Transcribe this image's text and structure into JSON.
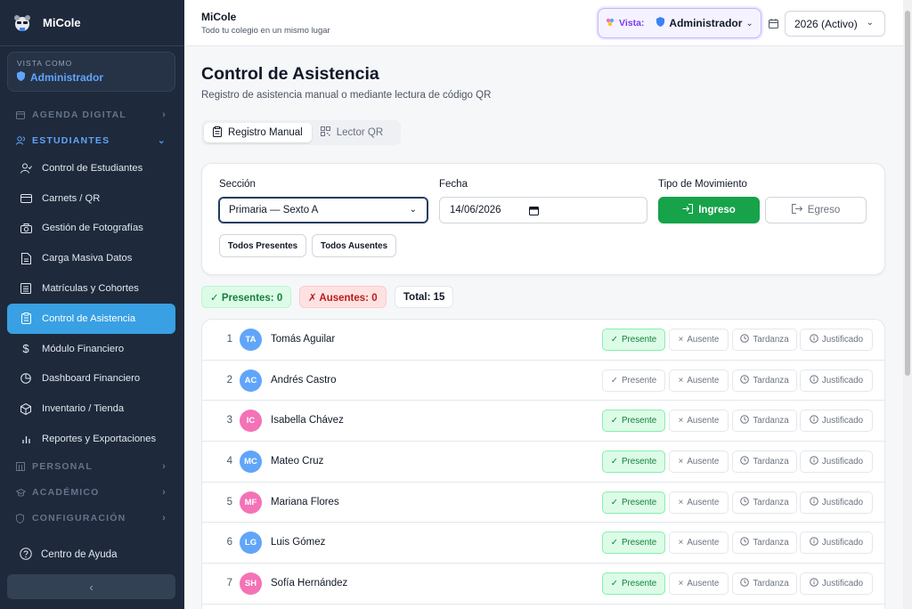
{
  "brand": {
    "name": "MiCole"
  },
  "view_as": {
    "label": "VISTA COMO",
    "value": "Administrador"
  },
  "nav": {
    "groups": [
      {
        "label": "AGENDA DIGITAL",
        "icon": "calendar-icon"
      },
      {
        "label": "ESTUDIANTES",
        "icon": "users-icon"
      },
      {
        "label": "PERSONAL",
        "icon": "building-icon"
      },
      {
        "label": "ACADÉMICO",
        "icon": "graduation-cap-icon"
      },
      {
        "label": "CONFIGURACIÓN",
        "icon": "shield-icon"
      }
    ],
    "items": [
      {
        "label": "Control de Estudiantes",
        "icon": "user-check-icon"
      },
      {
        "label": "Carnets / QR",
        "icon": "id-card-icon"
      },
      {
        "label": "Gestión de Fotografías",
        "icon": "camera-icon"
      },
      {
        "label": "Carga Masiva Datos",
        "icon": "file-upload-icon"
      },
      {
        "label": "Matrículas y Cohortes",
        "icon": "list-icon"
      },
      {
        "label": "Control de Asistencia",
        "icon": "clipboard-icon"
      },
      {
        "label": "Módulo Financiero",
        "icon": "dollar-icon"
      },
      {
        "label": "Dashboard Financiero",
        "icon": "pie-chart-icon"
      },
      {
        "label": "Inventario / Tienda",
        "icon": "package-icon"
      },
      {
        "label": "Reportes y Exportaciones",
        "icon": "bar-chart-icon"
      }
    ],
    "help": "Centro de Ayuda",
    "collapse": "‹"
  },
  "header": {
    "title": "MiCole",
    "subtitle": "Todo tu colegio en un mismo lugar",
    "vista_label": "Vista:",
    "vista_value": "Administrador",
    "year": "2026 (Activo)"
  },
  "page": {
    "title": "Control de Asistencia",
    "subtitle": "Registro de asistencia manual o mediante lectura de código QR",
    "tabs": [
      "Registro Manual",
      "Lector QR"
    ]
  },
  "form": {
    "section_label": "Sección",
    "section_value": "Primaria — Sexto A",
    "date_label": "Fecha",
    "date_value": "14/06/2026",
    "movement_label": "Tipo de Movimiento",
    "btn_in": "Ingreso",
    "btn_out": "Egreso",
    "all_present": "Todos Presentes",
    "all_absent": "Todos Ausentes"
  },
  "summary": {
    "present": "✓ Presentes: 0",
    "absent": "✗ Ausentes: 0",
    "total": "Total: 15"
  },
  "status_labels": {
    "present": "Presente",
    "absent": "Ausente",
    "late": "Tardanza",
    "justified": "Justificado"
  },
  "colors": {
    "accent": "#38a0e3",
    "green": "#16a34a",
    "blue_avatar": "#60a5fa",
    "pink_avatar": "#f472b6"
  },
  "students": [
    {
      "n": "1",
      "initials": "TA",
      "name": "Tomás Aguilar",
      "gender": "m"
    },
    {
      "n": "2",
      "initials": "AC",
      "name": "Andrés Castro",
      "gender": "m"
    },
    {
      "n": "3",
      "initials": "IC",
      "name": "Isabella Chávez",
      "gender": "f"
    },
    {
      "n": "4",
      "initials": "MC",
      "name": "Mateo Cruz",
      "gender": "m"
    },
    {
      "n": "5",
      "initials": "MF",
      "name": "Mariana Flores",
      "gender": "f"
    },
    {
      "n": "6",
      "initials": "LG",
      "name": "Luis Gómez",
      "gender": "m"
    },
    {
      "n": "7",
      "initials": "SH",
      "name": "Sofía Hernández",
      "gender": "f"
    }
  ]
}
